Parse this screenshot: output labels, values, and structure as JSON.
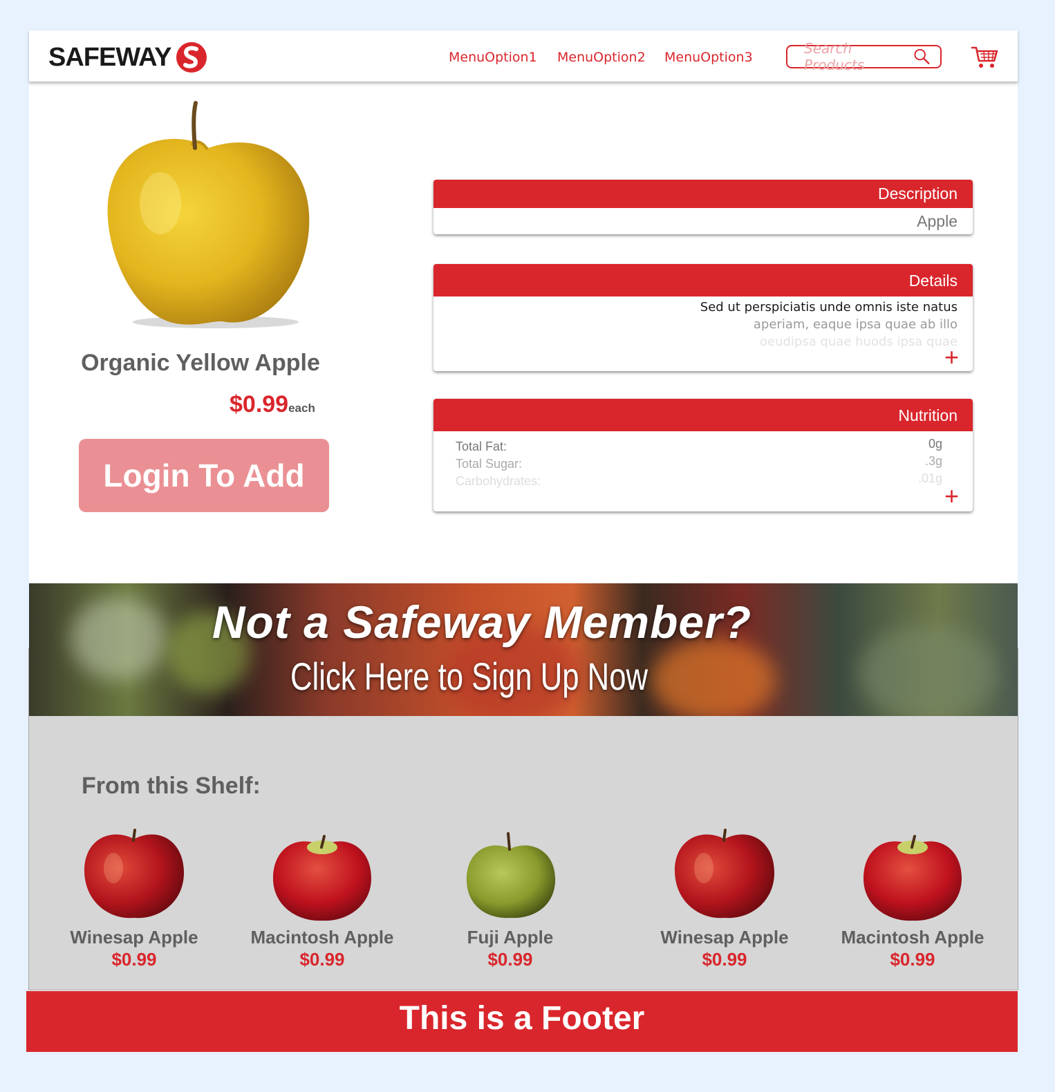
{
  "header": {
    "logo_text": "SAFEWAY",
    "nav": [
      "MenuOption1",
      "MenuOption2",
      "MenuOption3"
    ],
    "search_placeholder": "Search Products",
    "icons": {
      "search": "search-icon",
      "cart": "cart-icon"
    }
  },
  "product": {
    "name": "Organic Yellow Apple",
    "price": "$0.99",
    "unit": "each",
    "cta": "Login To Add"
  },
  "panels": {
    "description": {
      "title": "Description",
      "value": "Apple"
    },
    "details": {
      "title": "Details",
      "lines": [
        "Sed ut perspiciatis unde omnis iste natus",
        "aperiam, eaque ipsa quae ab illo",
        "oeudipsa quae huods ipsa quae"
      ]
    },
    "nutrition": {
      "title": "Nutrition",
      "rows": [
        {
          "label": "Total Fat:",
          "value": "0g"
        },
        {
          "label": "Total Sugar:",
          "value": ".3g"
        },
        {
          "label": "Carbohydrates:",
          "value": ".01g"
        }
      ]
    }
  },
  "banner": {
    "title": "Not a Safeway Member?",
    "subtitle": "Click Here to Sign Up Now"
  },
  "shelf": {
    "title": "From this Shelf:",
    "items": [
      {
        "name": "Winesap Apple",
        "price": "$0.99",
        "color": "red"
      },
      {
        "name": "Macintosh Apple",
        "price": "$0.99",
        "color": "red"
      },
      {
        "name": "Fuji Apple",
        "price": "$0.99",
        "color": "green"
      },
      {
        "name": "Winesap Apple",
        "price": "$0.99",
        "color": "red"
      },
      {
        "name": "Macintosh Apple",
        "price": "$0.99",
        "color": "red"
      }
    ]
  },
  "footer": {
    "text": "This is a Footer"
  },
  "colors": {
    "brand_red": "#d9262c",
    "button_pink": "#ea9094",
    "shelf_gray": "#d6d6d6"
  }
}
